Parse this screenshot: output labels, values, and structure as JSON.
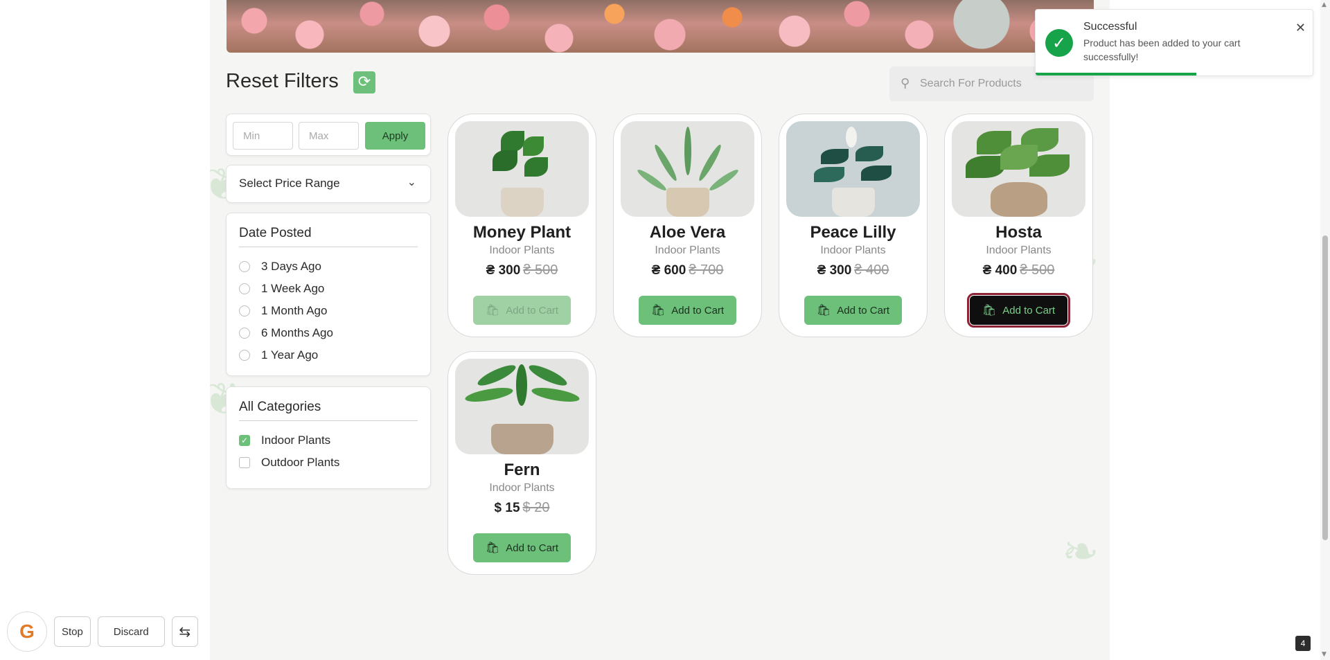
{
  "filters": {
    "reset_title": "Reset Filters",
    "min_placeholder": "Min",
    "max_placeholder": "Max",
    "apply_label": "Apply",
    "price_range_label": "Select Price Range",
    "date_title": "Date Posted",
    "date_options": [
      {
        "label": "3 Days Ago",
        "selected": false
      },
      {
        "label": "1 Week Ago",
        "selected": false
      },
      {
        "label": "1 Month Ago",
        "selected": false
      },
      {
        "label": "6 Months Ago",
        "selected": false
      },
      {
        "label": "1 Year Ago",
        "selected": false
      }
    ],
    "categories_title": "All Categories",
    "categories": [
      {
        "label": "Indoor Plants",
        "checked": true
      },
      {
        "label": "Outdoor Plants",
        "checked": false
      }
    ]
  },
  "search": {
    "placeholder": "Search For Products"
  },
  "products": [
    {
      "name": "Money Plant",
      "category": "Indoor Plants",
      "price": "₴ 300",
      "old_price": "₴ 500",
      "button": "Add to Cart",
      "state": "disabled"
    },
    {
      "name": "Aloe Vera",
      "category": "Indoor Plants",
      "price": "₴ 600",
      "old_price": "₴ 700",
      "button": "Add to Cart",
      "state": "normal"
    },
    {
      "name": "Peace Lilly",
      "category": "Indoor Plants",
      "price": "₴ 300",
      "old_price": "₴ 400",
      "button": "Add to Cart",
      "state": "normal"
    },
    {
      "name": "Hosta",
      "category": "Indoor Plants",
      "price": "₴ 400",
      "old_price": "₴ 500",
      "button": "Add to Cart",
      "state": "active"
    },
    {
      "name": "Fern",
      "category": "Indoor Plants",
      "price": "$ 15",
      "old_price": "$ 20",
      "button": "Add to Cart",
      "state": "normal"
    }
  ],
  "toast": {
    "title": "Successful",
    "message": "Product has been added to your cart successfully!",
    "progress": 0.58
  },
  "toolbar": {
    "stop_label": "Stop",
    "discard_label": "Discard"
  },
  "page_badge": "4",
  "colors": {
    "accent_green": "#6cc07a",
    "toast_green": "#16a34a",
    "active_outline": "#8b2335"
  }
}
